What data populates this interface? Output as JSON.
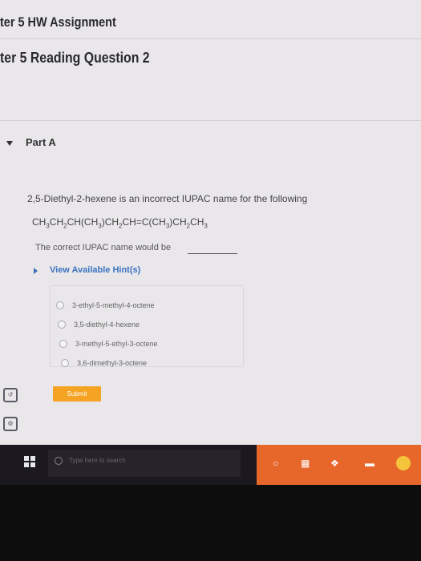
{
  "header": {
    "assignment_title": "ter 5 HW Assignment",
    "question_title": "ter 5 Reading Question 2"
  },
  "part": {
    "label": "Part A"
  },
  "question": {
    "line1": "2,5-Diethyl-2-hexene is an incorrect IUPAC name for the following",
    "formula_segments": [
      "CH",
      "3",
      "CH",
      "2",
      "CH(CH",
      "3",
      ")CH",
      "2",
      "CH=C(CH",
      "3",
      ")CH",
      "2",
      "CH",
      "3"
    ],
    "line3": "The correct IUPAC name would be"
  },
  "hints": {
    "label": "View Available Hint(s)"
  },
  "options": [
    "3-ethyl-5-methyl-4-octene",
    "3,5-diethyl-4-hexene",
    "3-methyl-5-ethyl-3-octene",
    "3,6-dimethyl-3-octene"
  ],
  "submit": {
    "label": "Submit"
  },
  "taskbar": {
    "search_placeholder": "Type here to search"
  }
}
